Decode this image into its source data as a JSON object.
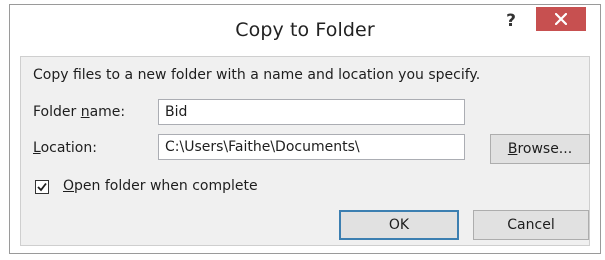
{
  "dialog": {
    "title": "Copy to Folder",
    "help_glyph": "?",
    "close_glyph": "✕"
  },
  "content": {
    "description": "Copy files to a new folder with a name and location you specify.",
    "folder_name": {
      "label_pre": "Folder ",
      "label_accel": "n",
      "label_post": "ame:",
      "value": "Bid"
    },
    "location": {
      "label_pre": "",
      "label_accel": "L",
      "label_post": "ocation:",
      "value": "C:\\Users\\Faithe\\Documents\\"
    },
    "browse_button": {
      "label_accel": "B",
      "label_post": "rowse..."
    },
    "open_folder_checkbox": {
      "checked": true,
      "label_accel": "O",
      "label_post": "pen folder when complete"
    },
    "ok_label": "OK",
    "cancel_label": "Cancel"
  },
  "colors": {
    "close_button_bg": "#c75050",
    "content_bg": "#f0f0f0",
    "default_button_border": "#3c7fb1"
  },
  "icons": {
    "close": "close-icon",
    "help": "help-icon",
    "checkmark": "checkmark-icon"
  }
}
